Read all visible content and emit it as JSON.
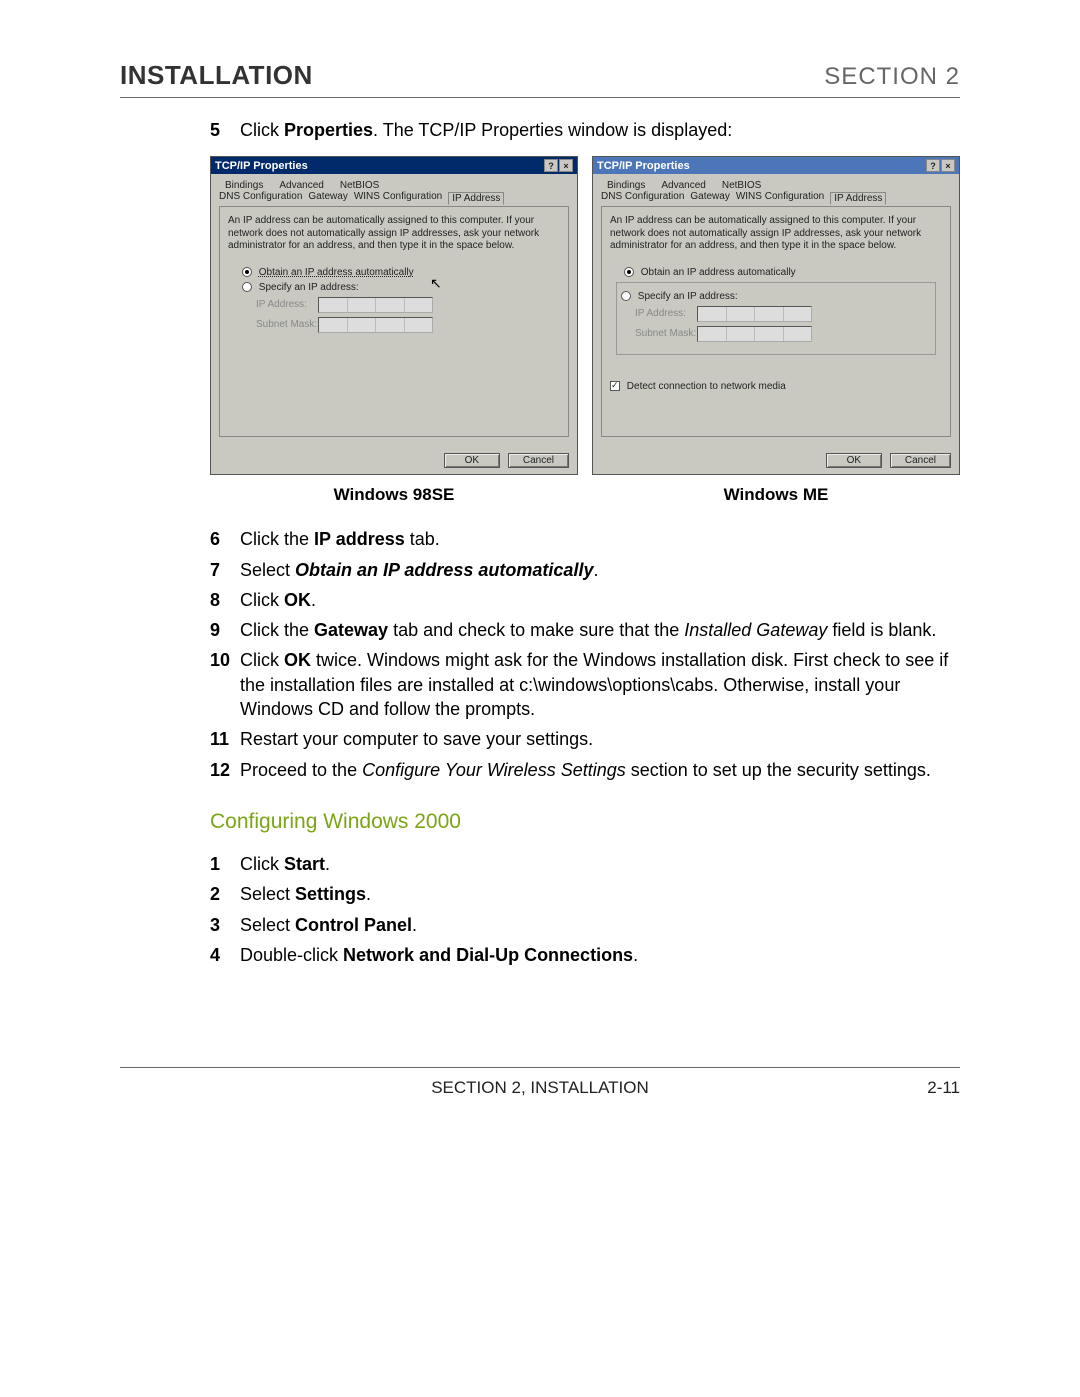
{
  "header": {
    "left": "INSTALLATION",
    "right": "SECTION 2"
  },
  "steps1": [
    {
      "num": "5",
      "html": "Click <b>Properties</b>. The TCP/IP Properties window is displayed:"
    }
  ],
  "dlg": {
    "title": "TCP/IP Properties",
    "help_btn": "?",
    "close_btn": "×",
    "tabs_top": [
      "Bindings",
      "Advanced",
      "NetBIOS"
    ],
    "tabs_bot": [
      "DNS Configuration",
      "Gateway",
      "WINS Configuration",
      "IP Address"
    ],
    "hint": "An IP address can be automatically assigned to this computer. If your network does not automatically assign IP addresses, ask your network administrator for an address, and then type it in the space below.",
    "radio_obtain": "Obtain an IP address automatically",
    "radio_specify": "Specify an IP address:",
    "field_ip": "IP Address:",
    "field_mask": "Subnet Mask:",
    "detect": "Detect connection to network media",
    "ok": "OK",
    "cancel": "Cancel"
  },
  "captions": {
    "left": "Windows 98SE",
    "right": "Windows ME"
  },
  "steps2": [
    {
      "num": "6",
      "html": "Click the <b>IP address</b> tab."
    },
    {
      "num": "7",
      "html": "Select <span class=\"bi\">Obtain an IP address automatically</span>."
    },
    {
      "num": "8",
      "html": "Click <b>OK</b>."
    },
    {
      "num": "9",
      "html": "Click the <b>Gateway</b> tab and check to make sure that the <i>Installed Gateway</i> field is blank."
    },
    {
      "num": "10",
      "html": "Click <b>OK</b> twice. Windows might ask for the Windows installation disk. First check to see if the installation files are installed at c:\\windows\\options\\cabs. Otherwise, install your Windows CD and follow the prompts."
    },
    {
      "num": "11",
      "html": "Restart your computer to save your settings."
    },
    {
      "num": "12",
      "html": "Proceed to the <i>Configure Your Wireless Settings</i> section to set up the security settings."
    }
  ],
  "subheading": "Configuring Windows 2000",
  "steps3": [
    {
      "num": "1",
      "html": "Click <b>Start</b>."
    },
    {
      "num": "2",
      "html": "Select <b>Settings</b>."
    },
    {
      "num": "3",
      "html": "Select <b>Control Panel</b>."
    },
    {
      "num": "4",
      "html": "Double-click <b>Network and Dial-Up Connections</b>."
    }
  ],
  "footer": {
    "center": "SECTION 2, INSTALLATION",
    "right": "2-11"
  }
}
